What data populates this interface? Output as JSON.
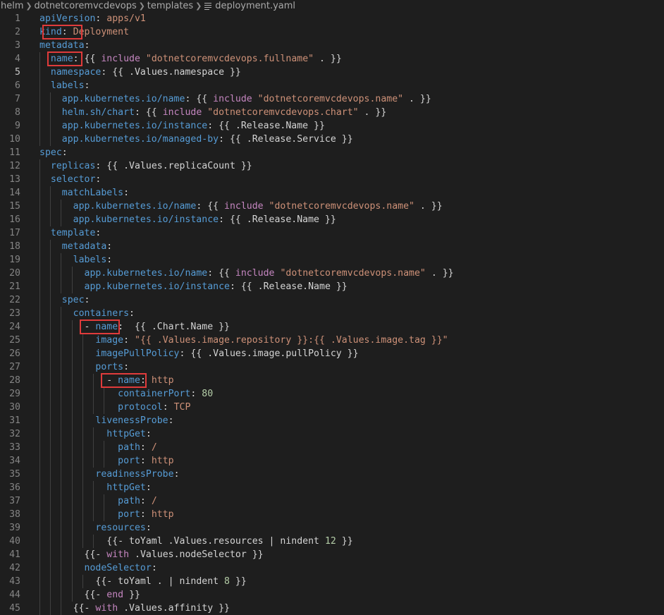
{
  "breadcrumb": {
    "segments": [
      "helm",
      "dotnetcoremvcdevops",
      "templates"
    ],
    "file_icon": "file-lines-icon",
    "file": "deployment.yaml",
    "separator_icon": "chevron-right-icon"
  },
  "editor": {
    "active_line": 5,
    "highlight_color": "#e03b3b",
    "lines": [
      [
        [
          "k",
          "apiVersion"
        ],
        [
          "v",
          ": "
        ],
        [
          "s",
          "apps/v1"
        ]
      ],
      [
        [
          "k",
          "kind"
        ],
        [
          "v",
          ": "
        ],
        [
          "s",
          "Deployment"
        ]
      ],
      [
        [
          "k",
          "metadata"
        ],
        [
          "v",
          ":"
        ]
      ],
      [
        [
          "v",
          "  "
        ],
        [
          "k",
          "name"
        ],
        [
          "v",
          ": {{ "
        ],
        [
          "fn",
          "include"
        ],
        [
          "v",
          " "
        ],
        [
          "s",
          "\"dotnetcoremvcdevops.fullname\""
        ],
        [
          "v",
          " . }}"
        ]
      ],
      [
        [
          "v",
          "  "
        ],
        [
          "k",
          "namespace"
        ],
        [
          "v",
          ": {{ .Values.namespace }}"
        ]
      ],
      [
        [
          "v",
          "  "
        ],
        [
          "k",
          "labels"
        ],
        [
          "v",
          ":"
        ]
      ],
      [
        [
          "v",
          "    "
        ],
        [
          "k",
          "app.kubernetes.io/name"
        ],
        [
          "v",
          ": {{ "
        ],
        [
          "fn",
          "include"
        ],
        [
          "v",
          " "
        ],
        [
          "s",
          "\"dotnetcoremvcdevops.name\""
        ],
        [
          "v",
          " . }}"
        ]
      ],
      [
        [
          "v",
          "    "
        ],
        [
          "k",
          "helm.sh/chart"
        ],
        [
          "v",
          ": {{ "
        ],
        [
          "fn",
          "include"
        ],
        [
          "v",
          " "
        ],
        [
          "s",
          "\"dotnetcoremvcdevops.chart\""
        ],
        [
          "v",
          " . }}"
        ]
      ],
      [
        [
          "v",
          "    "
        ],
        [
          "k",
          "app.kubernetes.io/instance"
        ],
        [
          "v",
          ": {{ .Release.Name }}"
        ]
      ],
      [
        [
          "v",
          "    "
        ],
        [
          "k",
          "app.kubernetes.io/managed-by"
        ],
        [
          "v",
          ": {{ .Release.Service }}"
        ]
      ],
      [
        [
          "k",
          "spec"
        ],
        [
          "v",
          ":"
        ]
      ],
      [
        [
          "v",
          "  "
        ],
        [
          "k",
          "replicas"
        ],
        [
          "v",
          ": {{ .Values.replicaCount }}"
        ]
      ],
      [
        [
          "v",
          "  "
        ],
        [
          "k",
          "selector"
        ],
        [
          "v",
          ":"
        ]
      ],
      [
        [
          "v",
          "    "
        ],
        [
          "k",
          "matchLabels"
        ],
        [
          "v",
          ":"
        ]
      ],
      [
        [
          "v",
          "      "
        ],
        [
          "k",
          "app.kubernetes.io/name"
        ],
        [
          "v",
          ": {{ "
        ],
        [
          "fn",
          "include"
        ],
        [
          "v",
          " "
        ],
        [
          "s",
          "\"dotnetcoremvcdevops.name\""
        ],
        [
          "v",
          " . }}"
        ]
      ],
      [
        [
          "v",
          "      "
        ],
        [
          "k",
          "app.kubernetes.io/instance"
        ],
        [
          "v",
          ": {{ .Release.Name }}"
        ]
      ],
      [
        [
          "v",
          "  "
        ],
        [
          "k",
          "template"
        ],
        [
          "v",
          ":"
        ]
      ],
      [
        [
          "v",
          "    "
        ],
        [
          "k",
          "metadata"
        ],
        [
          "v",
          ":"
        ]
      ],
      [
        [
          "v",
          "      "
        ],
        [
          "k",
          "labels"
        ],
        [
          "v",
          ":"
        ]
      ],
      [
        [
          "v",
          "        "
        ],
        [
          "k",
          "app.kubernetes.io/name"
        ],
        [
          "v",
          ": {{ "
        ],
        [
          "fn",
          "include"
        ],
        [
          "v",
          " "
        ],
        [
          "s",
          "\"dotnetcoremvcdevops.name\""
        ],
        [
          "v",
          " . }}"
        ]
      ],
      [
        [
          "v",
          "        "
        ],
        [
          "k",
          "app.kubernetes.io/instance"
        ],
        [
          "v",
          ": {{ .Release.Name }}"
        ]
      ],
      [
        [
          "v",
          "    "
        ],
        [
          "k",
          "spec"
        ],
        [
          "v",
          ":"
        ]
      ],
      [
        [
          "v",
          "      "
        ],
        [
          "k",
          "containers"
        ],
        [
          "v",
          ":"
        ]
      ],
      [
        [
          "v",
          "        "
        ],
        [
          "v",
          "- "
        ],
        [
          "k",
          "name"
        ],
        [
          "v",
          ":  {{ .Chart.Name }}"
        ]
      ],
      [
        [
          "v",
          "          "
        ],
        [
          "k",
          "image"
        ],
        [
          "v",
          ": "
        ],
        [
          "s",
          "\"{{ .Values.image.repository }}:{{ .Values.image.tag }}\""
        ]
      ],
      [
        [
          "v",
          "          "
        ],
        [
          "k",
          "imagePullPolicy"
        ],
        [
          "v",
          ": {{ .Values.image.pullPolicy }}"
        ]
      ],
      [
        [
          "v",
          "          "
        ],
        [
          "k",
          "ports"
        ],
        [
          "v",
          ":"
        ]
      ],
      [
        [
          "v",
          "            "
        ],
        [
          "v",
          "- "
        ],
        [
          "k",
          "name"
        ],
        [
          "v",
          ": "
        ],
        [
          "s",
          "http"
        ]
      ],
      [
        [
          "v",
          "              "
        ],
        [
          "k",
          "containerPort"
        ],
        [
          "v",
          ": "
        ],
        [
          "n",
          "80"
        ]
      ],
      [
        [
          "v",
          "              "
        ],
        [
          "k",
          "protocol"
        ],
        [
          "v",
          ": "
        ],
        [
          "s",
          "TCP"
        ]
      ],
      [
        [
          "v",
          "          "
        ],
        [
          "k",
          "livenessProbe"
        ],
        [
          "v",
          ":"
        ]
      ],
      [
        [
          "v",
          "            "
        ],
        [
          "k",
          "httpGet"
        ],
        [
          "v",
          ":"
        ]
      ],
      [
        [
          "v",
          "              "
        ],
        [
          "k",
          "path"
        ],
        [
          "v",
          ": "
        ],
        [
          "s",
          "/"
        ]
      ],
      [
        [
          "v",
          "              "
        ],
        [
          "k",
          "port"
        ],
        [
          "v",
          ": "
        ],
        [
          "s",
          "http"
        ]
      ],
      [
        [
          "v",
          "          "
        ],
        [
          "k",
          "readinessProbe"
        ],
        [
          "v",
          ":"
        ]
      ],
      [
        [
          "v",
          "            "
        ],
        [
          "k",
          "httpGet"
        ],
        [
          "v",
          ":"
        ]
      ],
      [
        [
          "v",
          "              "
        ],
        [
          "k",
          "path"
        ],
        [
          "v",
          ": "
        ],
        [
          "s",
          "/"
        ]
      ],
      [
        [
          "v",
          "              "
        ],
        [
          "k",
          "port"
        ],
        [
          "v",
          ": "
        ],
        [
          "s",
          "http"
        ]
      ],
      [
        [
          "v",
          "          "
        ],
        [
          "k",
          "resources"
        ],
        [
          "v",
          ":"
        ]
      ],
      [
        [
          "v",
          "            "
        ],
        [
          "v",
          "{{- toYaml .Values.resources | nindent "
        ],
        [
          "n",
          "12"
        ],
        [
          "v",
          " }}"
        ]
      ],
      [
        [
          "v",
          "        "
        ],
        [
          "v",
          "{{- "
        ],
        [
          "fn",
          "with"
        ],
        [
          "v",
          " .Values.nodeSelector }}"
        ]
      ],
      [
        [
          "v",
          "        "
        ],
        [
          "k",
          "nodeSelector"
        ],
        [
          "v",
          ":"
        ]
      ],
      [
        [
          "v",
          "          "
        ],
        [
          "v",
          "{{- toYaml . | nindent "
        ],
        [
          "n",
          "8"
        ],
        [
          "v",
          " }}"
        ]
      ],
      [
        [
          "v",
          "        "
        ],
        [
          "v",
          "{{- "
        ],
        [
          "fn",
          "end"
        ],
        [
          "v",
          " }}"
        ]
      ],
      [
        [
          "v",
          "      "
        ],
        [
          "v",
          "{{- "
        ],
        [
          "fn",
          "with"
        ],
        [
          "v",
          " .Values.affinity }}"
        ]
      ]
    ]
  }
}
